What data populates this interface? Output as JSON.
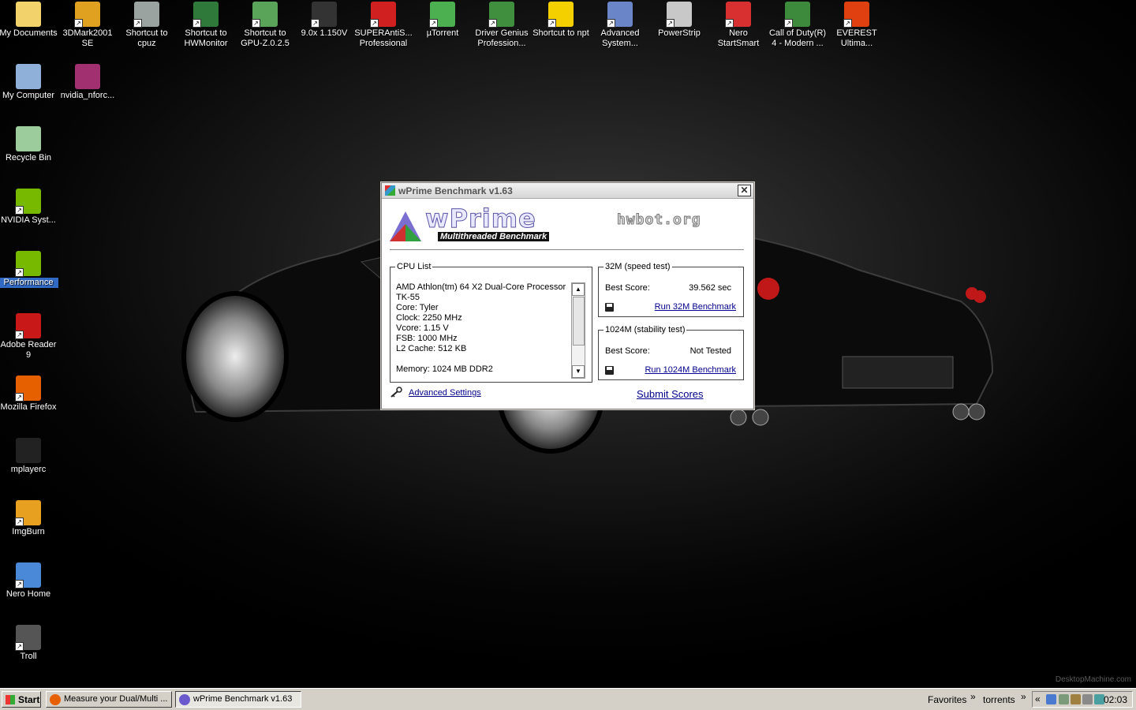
{
  "desktop": {
    "watermark": "DesktopMachine.com",
    "icons": [
      {
        "label": "My Documents",
        "icon": "folder-documents-icon",
        "color": "#f2d36b",
        "shortcut": false
      },
      {
        "label": "3DMark2001 SE",
        "icon": "3dmark-icon",
        "color": "#e0a020",
        "shortcut": true
      },
      {
        "label": "Shortcut to cpuz",
        "icon": "drive-icon",
        "color": "#9aa3a0",
        "shortcut": true
      },
      {
        "label": "Shortcut to HWMonitor",
        "icon": "motherboard-icon",
        "color": "#2f7a3a",
        "shortcut": true
      },
      {
        "label": "Shortcut to GPU-Z.0.2.5",
        "icon": "graphics-card-icon",
        "color": "#5aa45a",
        "shortcut": true
      },
      {
        "label": "9.0x 1.150V",
        "icon": "chip-icon",
        "color": "#333333",
        "shortcut": true
      },
      {
        "label": "SUPERAntiS... Professional",
        "icon": "antispyware-icon",
        "color": "#d02020",
        "shortcut": true
      },
      {
        "label": "µTorrent",
        "icon": "utorrent-icon",
        "color": "#4caf50",
        "shortcut": true
      },
      {
        "label": "Driver Genius Profession...",
        "icon": "driver-card-icon",
        "color": "#3f8f3f",
        "shortcut": true
      },
      {
        "label": "Shortcut to npt",
        "icon": "lightning-icon",
        "color": "#f5d000",
        "shortcut": true
      },
      {
        "label": "Advanced System...",
        "icon": "system-care-icon",
        "color": "#6a86c8",
        "shortcut": true
      },
      {
        "label": "PowerStrip",
        "icon": "powerstrip-icon",
        "color": "#c8c8c8",
        "shortcut": true
      },
      {
        "label": "Nero StartSmart",
        "icon": "nero-flame-icon",
        "color": "#d83030",
        "shortcut": true
      },
      {
        "label": "Call of Duty(R) 4 - Modern ...",
        "icon": "cod4-icon",
        "color": "#3d8a3d",
        "shortcut": true
      },
      {
        "label": "EVEREST Ultima...",
        "icon": "everest-info-icon",
        "color": "#e04010",
        "shortcut": true
      },
      {
        "label": "My Computer",
        "icon": "computer-icon",
        "color": "#8fb0d8",
        "shortcut": false
      },
      {
        "label": "nvidia_nforc...",
        "icon": "winrar-archive-icon",
        "color": "#a03070",
        "shortcut": false
      },
      {
        "label": "Recycle Bin",
        "icon": "recycle-bin-icon",
        "color": "#9ccc9c",
        "shortcut": false
      },
      {
        "label": "NVIDIA Syst...",
        "icon": "nvidia-icon",
        "color": "#76b900",
        "shortcut": true
      },
      {
        "label": "Performance",
        "icon": "nvidia-performance-icon",
        "color": "#76b900",
        "shortcut": true
      },
      {
        "label": "Adobe Reader 9",
        "icon": "adobe-reader-icon",
        "color": "#c81818",
        "shortcut": true
      },
      {
        "label": "Mozilla Firefox",
        "icon": "firefox-icon",
        "color": "#e66000",
        "shortcut": true
      },
      {
        "label": "mplayerc",
        "icon": "clapperboard-icon",
        "color": "#222222",
        "shortcut": false
      },
      {
        "label": "ImgBurn",
        "icon": "imgburn-disc-icon",
        "color": "#e8a020",
        "shortcut": true
      },
      {
        "label": "Nero Home",
        "icon": "nero-home-icon",
        "color": "#4a88d8",
        "shortcut": true
      },
      {
        "label": "Troll",
        "icon": "troll-icon",
        "color": "#555555",
        "shortcut": true
      }
    ]
  },
  "window": {
    "title": "wPrime Benchmark v1.63",
    "close_glyph": "✕",
    "logo_text": "wPrime",
    "logo_subtitle": "Multithreaded Benchmark",
    "hwbot_text": "hwbot.org",
    "cpu_list": {
      "legend": "CPU List",
      "lines": [
        "AMD Athlon(tm) 64 X2 Dual-Core Processor",
        "TK-55",
        "Core: Tyler",
        "Clock: 2250 MHz",
        "Vcore: 1.15 V",
        "FSB: 1000 MHz",
        "L2 Cache: 512 KB",
        "",
        "Memory: 1024 MB DDR2"
      ]
    },
    "test32": {
      "legend": "32M (speed test)",
      "best_label": "Best Score:",
      "best_value": "39.562 sec",
      "run_label": "Run 32M Benchmark"
    },
    "test1024": {
      "legend": "1024M (stability test)",
      "best_label": "Best Score:",
      "best_value": "Not Tested",
      "run_label": "Run 1024M Benchmark"
    },
    "advanced_settings": "Advanced Settings",
    "submit_scores": "Submit Scores"
  },
  "taskbar": {
    "start_label": "Start",
    "buttons": [
      {
        "label": "Measure your Dual/Multi ...",
        "icon": "firefox-icon",
        "color": "#e66000",
        "active": false
      },
      {
        "label": "wPrime Benchmark v1.63",
        "icon": "wprime-icon",
        "color": "#6a5acd",
        "active": true
      }
    ],
    "favorites": "Favorites",
    "torrents": "torrents",
    "chevron": "»",
    "tray_chevron": "«",
    "clock": "02:03"
  }
}
